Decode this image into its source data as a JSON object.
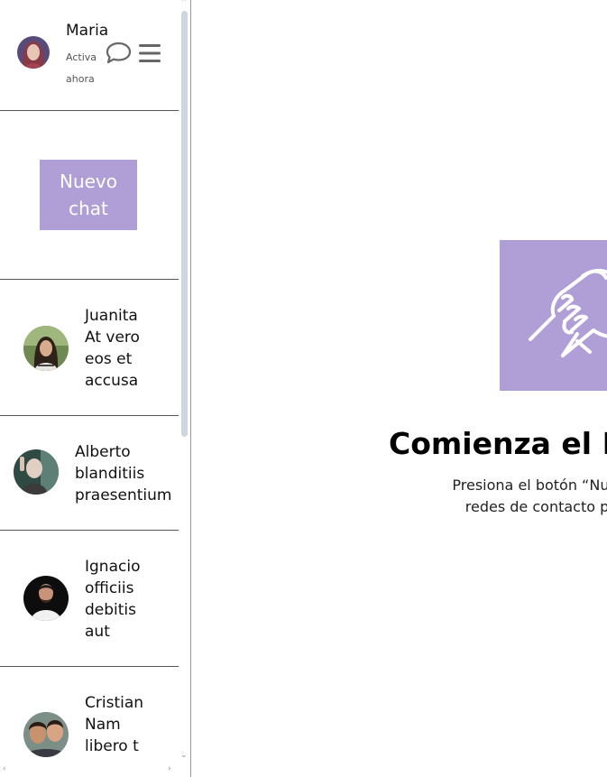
{
  "profile": {
    "name": "Maria",
    "status": "Activa ahora"
  },
  "new_chat": {
    "label": "Nuevo chat"
  },
  "contacts": [
    {
      "name": "Juanita",
      "preview": "At vero eos et accusa"
    },
    {
      "name": "Alberto",
      "preview": "blanditiis praesentium"
    },
    {
      "name": "Ignacio",
      "preview": "officiis debitis aut"
    },
    {
      "name": "Cristian",
      "preview": "Nam libero t"
    }
  ],
  "main": {
    "title": "Comienza el N",
    "description_line1": "Presiona el botón “Nuevo chat” par",
    "description_line2": "redes de contacto para tu empr"
  },
  "colors": {
    "accent": "#b09fd6",
    "divider": "#555555"
  },
  "icons": [
    "chat-bubble-icon",
    "menu-icon",
    "handshake-icon"
  ]
}
